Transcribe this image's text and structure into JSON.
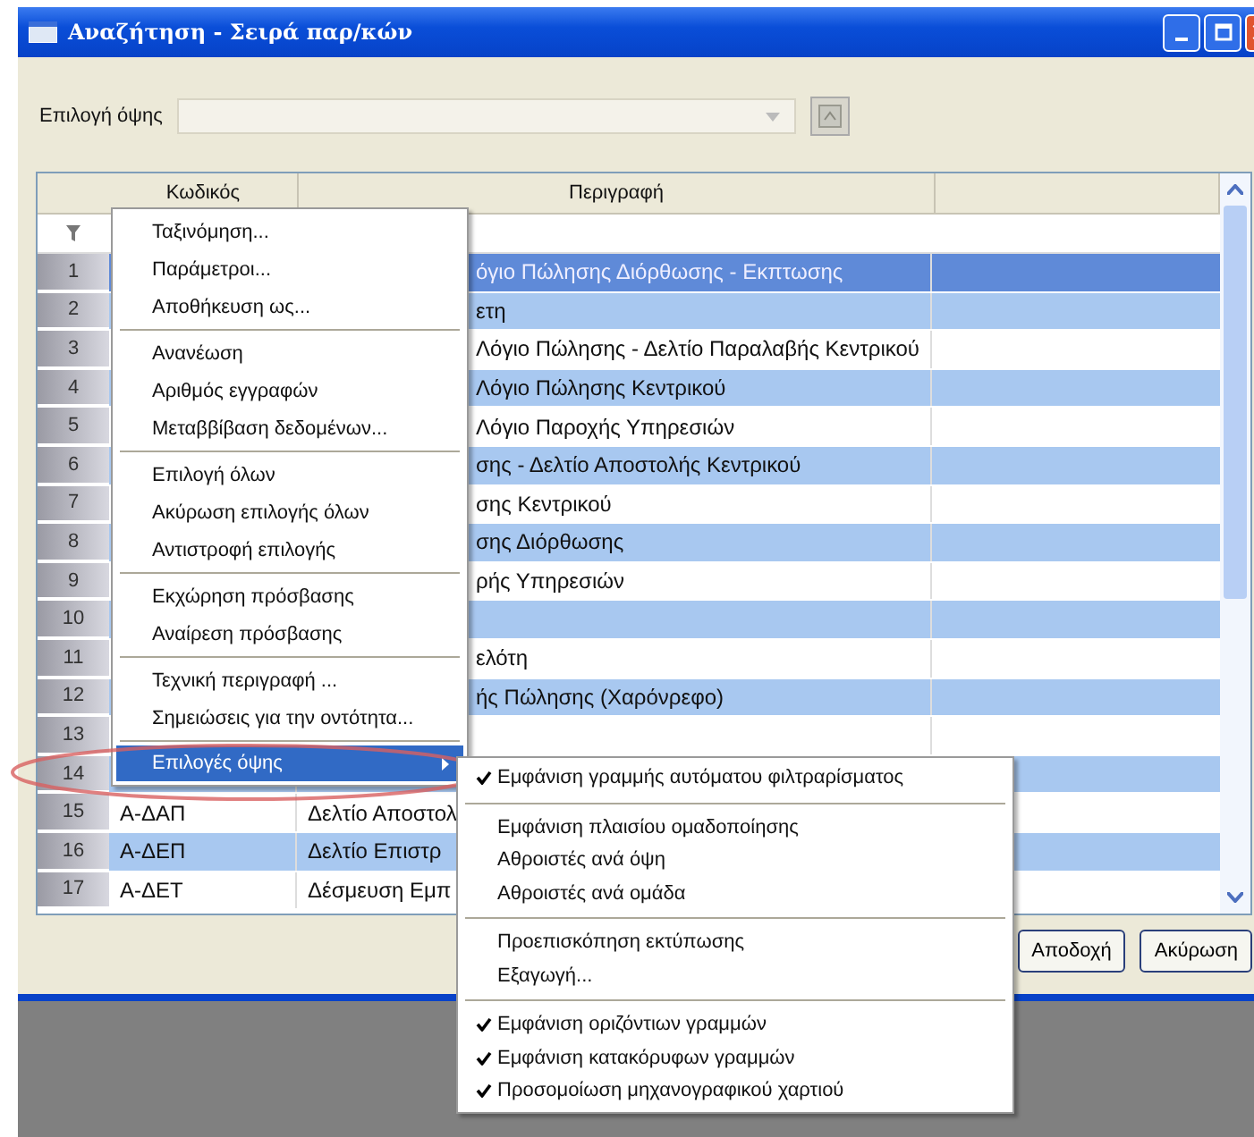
{
  "window": {
    "title": "Αναζήτηση - Σειρά παρ/κών"
  },
  "toolbar": {
    "label": "Επιλογή όψης",
    "combo_disabled": true
  },
  "table": {
    "columns": [
      "Κωδικός",
      "Περιγραφή"
    ],
    "rows": [
      {
        "num": "1",
        "code": "",
        "description": "όγιο Πώλησης Διόρθωσης - Εκπτωσης",
        "selected": true
      },
      {
        "num": "2",
        "code": "",
        "description": "ετη",
        "selected": false
      },
      {
        "num": "3",
        "code": "",
        "description": "Λόγιο Πώλησης - Δελτίο Παραλαβής Κεντρικού",
        "selected": false
      },
      {
        "num": "4",
        "code": "",
        "description": "Λόγιο Πώλησης Κεντρικού",
        "selected": false
      },
      {
        "num": "5",
        "code": "",
        "description": "Λόγιο Παροχής Υπηρεσιών",
        "selected": false
      },
      {
        "num": "6",
        "code": "",
        "description": "σης - Δελτίο Αποστολής Κεντρικού",
        "selected": false
      },
      {
        "num": "7",
        "code": "",
        "description": "σης Κεντρικού",
        "selected": false
      },
      {
        "num": "8",
        "code": "",
        "description": "σης Διόρθωσης",
        "selected": false
      },
      {
        "num": "9",
        "code": "",
        "description": "ρής Υπηρεσιών",
        "selected": false
      },
      {
        "num": "10",
        "code": "",
        "description": "",
        "selected": false
      },
      {
        "num": "11",
        "code": "",
        "description": "ελότη",
        "selected": false
      },
      {
        "num": "12",
        "code": "",
        "description": "ής Πώλησης (Χαρόνρεφο)",
        "selected": false
      },
      {
        "num": "13",
        "code": "",
        "description": "",
        "selected": false
      },
      {
        "num": "14",
        "code": "",
        "description": "",
        "selected": false
      },
      {
        "num": "15",
        "code": "Α-ΔΑΠ",
        "description": "Δελτίο Αποστολ",
        "selected": false
      },
      {
        "num": "16",
        "code": "Α-ΔΕΠ",
        "description": "Δελτίο Επιστρ",
        "selected": false
      },
      {
        "num": "17",
        "code": "Α-ΔΕΤ",
        "description": "Δέσμευση Εμπ",
        "selected": false
      }
    ]
  },
  "buttons": [
    "Αποδοχή",
    "Ακύρωση"
  ],
  "context_menu": {
    "groups": [
      [
        {
          "label": "Ταξινόμηση...",
          "selected": false,
          "submenu": false
        },
        {
          "label": "Παράμετροι...",
          "selected": false,
          "submenu": false
        },
        {
          "label": "Αποθήκευση ως...",
          "selected": false,
          "submenu": false
        }
      ],
      [
        {
          "label": "Ανανέωση",
          "selected": false,
          "submenu": false
        },
        {
          "label": "Αριθμός εγγραφών",
          "selected": false,
          "submenu": false
        },
        {
          "label": "Μεταββίβαση δεδομένων...",
          "selected": false,
          "submenu": false
        }
      ],
      [
        {
          "label": "Επιλογή όλων",
          "selected": false,
          "submenu": false
        },
        {
          "label": "Ακύρωση επιλογής όλων",
          "selected": false,
          "submenu": false
        },
        {
          "label": "Αντιστροφή επιλογής",
          "selected": false,
          "submenu": false
        }
      ],
      [
        {
          "label": "Εκχώρηση πρόσβασης",
          "selected": false,
          "submenu": false
        },
        {
          "label": "Αναίρεση πρόσβασης",
          "selected": false,
          "submenu": false
        }
      ],
      [
        {
          "label": "Τεχνική περιγραφή ...",
          "selected": false,
          "submenu": false
        },
        {
          "label": "Σημειώσεις για την οντότητα...",
          "selected": false,
          "submenu": false
        }
      ],
      [
        {
          "label": "Επιλογές όψης",
          "selected": true,
          "submenu": true
        }
      ]
    ]
  },
  "submenu": {
    "groups": [
      [
        {
          "label": "Εμφάνιση γραμμής αυτόματου φιλτραρίσματος",
          "checked": true
        }
      ],
      [
        {
          "label": "Εμφάνιση πλαισίου ομαδοποίησης",
          "checked": false
        },
        {
          "label": "Αθροιστές ανά όψη",
          "checked": false
        },
        {
          "label": "Αθροιστές ανά ομάδα",
          "checked": false
        }
      ],
      [
        {
          "label": "Προεπισκόπηση εκτύπωσης",
          "checked": false
        },
        {
          "label": "Εξαγωγή...",
          "checked": false
        }
      ],
      [
        {
          "label": "Εμφάνιση οριζόντιων γραμμών",
          "checked": true
        },
        {
          "label": "Εμφάνιση κατακόρυφων γραμμών",
          "checked": true
        },
        {
          "label": "Προσομοίωση μηχανογραφικού χαρτιού",
          "checked": true
        }
      ]
    ]
  }
}
